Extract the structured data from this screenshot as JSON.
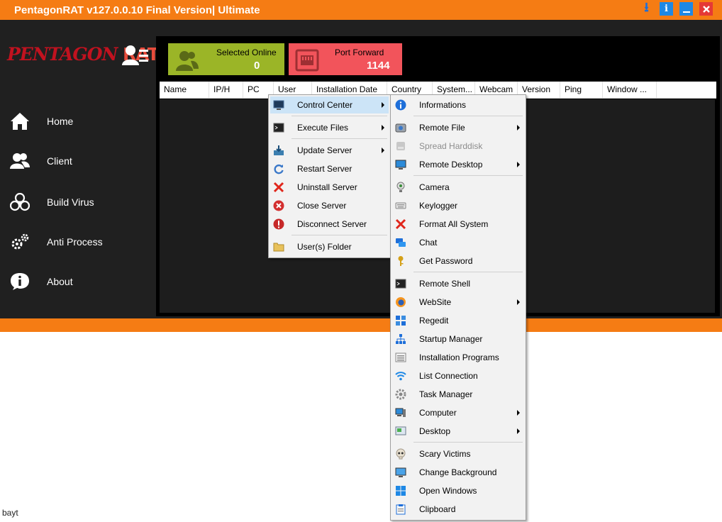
{
  "window": {
    "title": "PentagonRAT v127.0.0.10 Final Version| Ultimate"
  },
  "colors": {
    "accent": "#f57c14",
    "sidebar": "#202020",
    "online_tile": "#9bb527",
    "port_tile": "#f2545b",
    "highlight": "#cce4f7"
  },
  "logo": {
    "part1": "PENTAGON",
    "part2": "RAT"
  },
  "sidebar": {
    "items": [
      {
        "label": "Home",
        "icon": "home-icon"
      },
      {
        "label": "Client",
        "icon": "users-icon"
      },
      {
        "label": "Build Virus",
        "icon": "biohazard-icon"
      },
      {
        "label": "Anti Process",
        "icon": "gears-icon"
      },
      {
        "label": "About",
        "icon": "info-icon"
      }
    ]
  },
  "tiles": {
    "online": {
      "label": "Selected Online",
      "value": "0"
    },
    "port": {
      "label": "Port Forward",
      "value": "1144"
    }
  },
  "table": {
    "columns": [
      "Name",
      "IP/H",
      "PC",
      "User",
      "Installation Date",
      "Country",
      "System...",
      "Webcam",
      "Version",
      "Ping",
      "Window ..."
    ]
  },
  "context_menu": {
    "items": [
      {
        "label": "Control Center",
        "submenu": true,
        "highlighted": true
      },
      {
        "label": "Execute Files",
        "submenu": true
      },
      {
        "label": "Update Server",
        "submenu": true
      },
      {
        "label": "Restart Server"
      },
      {
        "label": "Uninstall Server"
      },
      {
        "label": "Close Server"
      },
      {
        "label": "Disconnect Server"
      },
      {
        "label": "User(s) Folder"
      }
    ]
  },
  "control_center_menu": {
    "items": [
      {
        "label": "Informations"
      },
      {
        "label": "Remote File",
        "submenu": true
      },
      {
        "label": "Spread Harddisk",
        "disabled": true
      },
      {
        "label": "Remote Desktop",
        "submenu": true
      },
      {
        "label": "Camera"
      },
      {
        "label": "Keylogger"
      },
      {
        "label": "Format All System"
      },
      {
        "label": "Chat"
      },
      {
        "label": "Get Password"
      },
      {
        "label": "Remote Shell"
      },
      {
        "label": "WebSite",
        "submenu": true
      },
      {
        "label": "Regedit"
      },
      {
        "label": "Startup Manager"
      },
      {
        "label": "Installation Programs"
      },
      {
        "label": "List Connection"
      },
      {
        "label": "Task Manager"
      },
      {
        "label": "Computer",
        "submenu": true
      },
      {
        "label": "Desktop",
        "submenu": true
      },
      {
        "label": "Scary Victims"
      },
      {
        "label": "Change Background"
      },
      {
        "label": "Open Windows"
      },
      {
        "label": "Clipboard"
      }
    ]
  },
  "status": {
    "text": "bayt"
  }
}
